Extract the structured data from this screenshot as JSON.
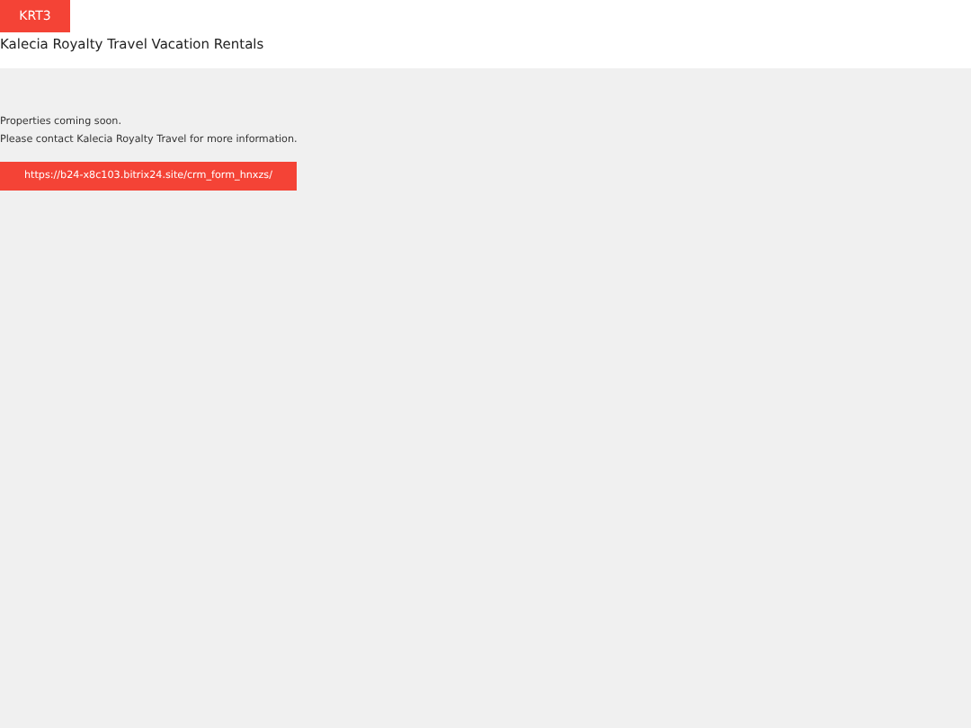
{
  "header": {
    "logo": "KRT3",
    "title": "Kalecia Royalty Travel Vacation Rentals"
  },
  "content": {
    "lines": [
      "Properties coming soon.",
      "Please contact Kalecia Royalty Travel for more information."
    ],
    "link_button": "https://b24-x8c103.bitrix24.site/crm_form_hnxzs/"
  }
}
